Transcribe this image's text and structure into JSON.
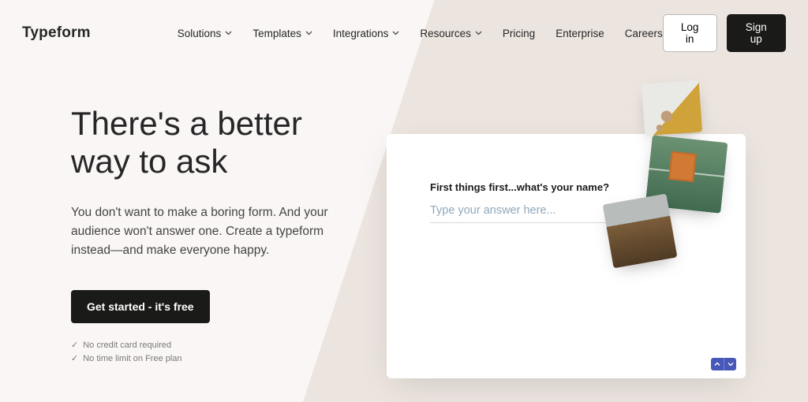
{
  "brand": {
    "logo": "Typeform"
  },
  "nav": {
    "items": [
      {
        "label": "Solutions",
        "dropdown": true
      },
      {
        "label": "Templates",
        "dropdown": true
      },
      {
        "label": "Integrations",
        "dropdown": true
      },
      {
        "label": "Resources",
        "dropdown": true
      },
      {
        "label": "Pricing",
        "dropdown": false
      },
      {
        "label": "Enterprise",
        "dropdown": false
      },
      {
        "label": "Careers",
        "dropdown": false
      }
    ],
    "login": "Log in",
    "signup": "Sign up"
  },
  "hero": {
    "title_line1": "There's a better",
    "title_line2": "way to ask",
    "subtitle": "You don't want to make a boring form. And your audience won't answer one. Create a typeform instead—and make everyone happy.",
    "cta": "Get started - it's free",
    "bullets": [
      "No credit card required",
      "No time limit on Free plan"
    ]
  },
  "preview": {
    "question": "First things first...what's your name?",
    "placeholder": "Type your answer here..."
  },
  "tiles": [
    {
      "name": "tile-coffee"
    },
    {
      "name": "tile-tennis-court"
    },
    {
      "name": "tile-coral-reef"
    }
  ],
  "colors": {
    "text": "#262627",
    "cta_bg": "#1a1a19",
    "accent": "#4758b8",
    "page_bg": "#f9f6f5",
    "shape_bg": "#ece5df"
  }
}
